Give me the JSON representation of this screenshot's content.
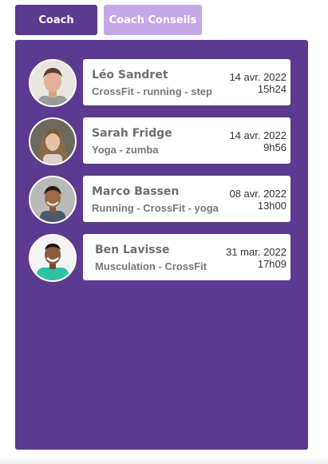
{
  "tabs": {
    "coach": "Coach",
    "conseils": "Coach Conseils"
  },
  "colors": {
    "primary": "#5b3a8f",
    "secondary": "#c6a8e6",
    "card": "#ffffff"
  },
  "coaches": [
    {
      "name": "Léo Sandret",
      "specialty": "CrossFit - running - step",
      "date": "14 avr. 2022",
      "time": "15h24"
    },
    {
      "name": "Sarah Fridge",
      "specialty": "Yoga - zumba",
      "date": "14 avr. 2022",
      "time": "9h56"
    },
    {
      "name": "Marco Bassen",
      "specialty": "Running - CrossFit - yoga",
      "date": "08 avr. 2022",
      "time": "13h00"
    },
    {
      "name": "Ben Lavisse",
      "specialty": "Musculation - CrossFit",
      "date": "31 mar. 2022",
      "time": "17h09"
    }
  ]
}
